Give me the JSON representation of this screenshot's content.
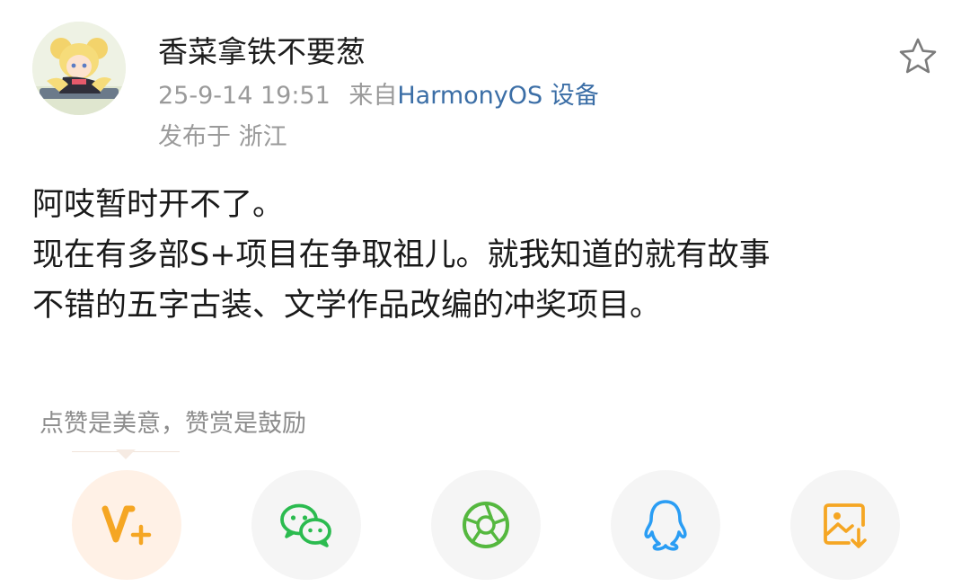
{
  "post": {
    "username": "香菜拿铁不要葱",
    "date": "25-9-14 19:51",
    "source_prefix": "来自",
    "device": "HarmonyOS 设备",
    "location": "发布于 浙江",
    "paragraphs": [
      "阿吱暂时开不了。",
      "现在有多部S+项目在争取祖儿。就我知道的就有故事",
      "不错的五字古装、文学作品改编的冲奖项目。"
    ]
  },
  "reward_hint": "点赞是美意，赞赏是鼓励",
  "share_buttons": [
    {
      "icon": "vplus-reward-icon"
    },
    {
      "icon": "wechat-icon"
    },
    {
      "icon": "moments-icon"
    },
    {
      "icon": "qq-icon"
    },
    {
      "icon": "save-image-icon"
    }
  ],
  "colors": {
    "accent_orange": "#f5a623",
    "wechat_green": "#2bbb4f",
    "moments_green": "#55b83f",
    "qq_blue": "#2a9df4",
    "device_link": "#3b6ea6"
  }
}
